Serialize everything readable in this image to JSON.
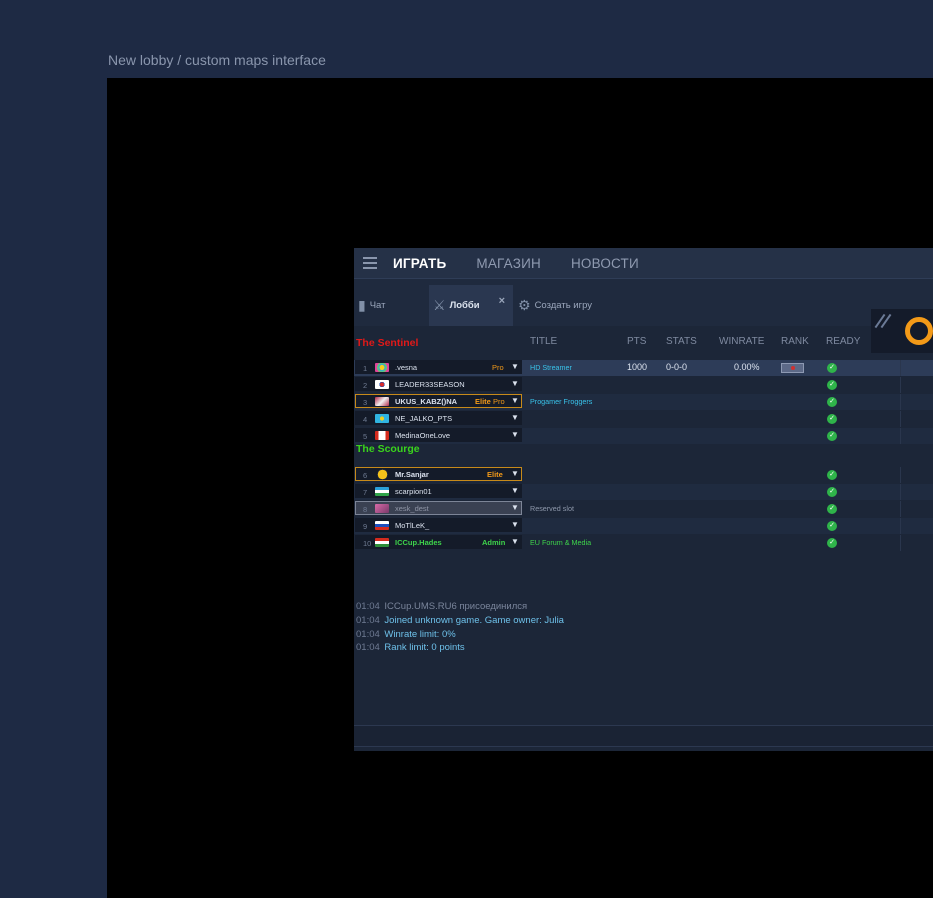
{
  "page_caption": "New lobby / custom maps interface",
  "nav": {
    "items": [
      {
        "label": "ИГРАТЬ",
        "active": true
      },
      {
        "label": "МАГАЗИН",
        "active": false
      },
      {
        "label": "НОВОСТИ",
        "active": false
      }
    ]
  },
  "tabs": [
    {
      "label": "Чат",
      "icon": "chat-bubble-icon"
    },
    {
      "label": "Лобби",
      "icon": "crossed-swords-icon",
      "active": true,
      "close": "×"
    },
    {
      "label": "Создать игру",
      "icon": "create-game-icon"
    }
  ],
  "columns": {
    "title": "TITLE",
    "pts": "PTS",
    "stats": "STATS",
    "winrate": "WINRATE",
    "rank": "RANK",
    "ready": "READY"
  },
  "teams": [
    {
      "name": "The Sentinel",
      "color": "#e01919"
    },
    {
      "name": "The Scourge",
      "color": "#3ad41c"
    }
  ],
  "players": [
    {
      "slot": "1",
      "name": ".vesna",
      "badge": "Pro",
      "title": "HD Streamer",
      "pts": "1000",
      "stats": "0-0-0",
      "winrate": "0.00%",
      "ready": "✓",
      "flag": "flower-avatar-icon"
    },
    {
      "slot": "2",
      "name": "LEADER33SEASON",
      "badge": "",
      "title": "",
      "ready": "✓",
      "flag": "korea-flag-icon"
    },
    {
      "slot": "3",
      "name": "UKUS_KABZ()NA",
      "badge": "Elite",
      "badge2": "Pro",
      "title": "Progamer Froggers",
      "ready": "✓",
      "flag": "bat-avatar-icon"
    },
    {
      "slot": "4",
      "name": "NE_JALKO_PTS",
      "badge": "",
      "title": "",
      "ready": "✓",
      "flag": "kazakhstan-flag-icon"
    },
    {
      "slot": "5",
      "name": "MedinaOneLove",
      "badge": "",
      "title": "",
      "ready": "✓",
      "flag": "canada-flag-icon"
    },
    {
      "slot": "6",
      "name": "Mr.Sanjar",
      "badge": "Elite",
      "title": "",
      "ready": "✓",
      "flag": "smiley-avatar-icon"
    },
    {
      "slot": "7",
      "name": "scarpion01",
      "badge": "",
      "title": "",
      "ready": "✓",
      "flag": "uzbekistan-flag-icon"
    },
    {
      "slot": "8",
      "name": "xesk_dest",
      "badge": "",
      "title": "Reserved slot",
      "ready": "✓",
      "flag": "pink-avatar-icon"
    },
    {
      "slot": "9",
      "name": "MoTlLeK_",
      "badge": "",
      "title": "",
      "ready": "✓",
      "flag": "russia-flag-icon"
    },
    {
      "slot": "10",
      "name": "ICCup.Hades",
      "badge": "Admin",
      "title": "EU Forum & Media",
      "ready": "✓",
      "flag": "tajikistan-flag-icon"
    }
  ],
  "dropdown_glyph": "▼",
  "log": [
    {
      "time": "01:04",
      "text": "ICCup.UMS.RU6 присоединился",
      "dim": true
    },
    {
      "time": "01:04",
      "text": "Joined unknown game. Game owner: Julia"
    },
    {
      "time": "01:04",
      "text": "Winrate limit: 0%"
    },
    {
      "time": "01:04",
      "text": "Rank limit: 0 points"
    }
  ],
  "colors": {
    "accent_orange": "#f39a18",
    "ready_green": "#2fb44a",
    "title_cyan": "#39c3ea",
    "admin_green": "#3ed44b"
  }
}
